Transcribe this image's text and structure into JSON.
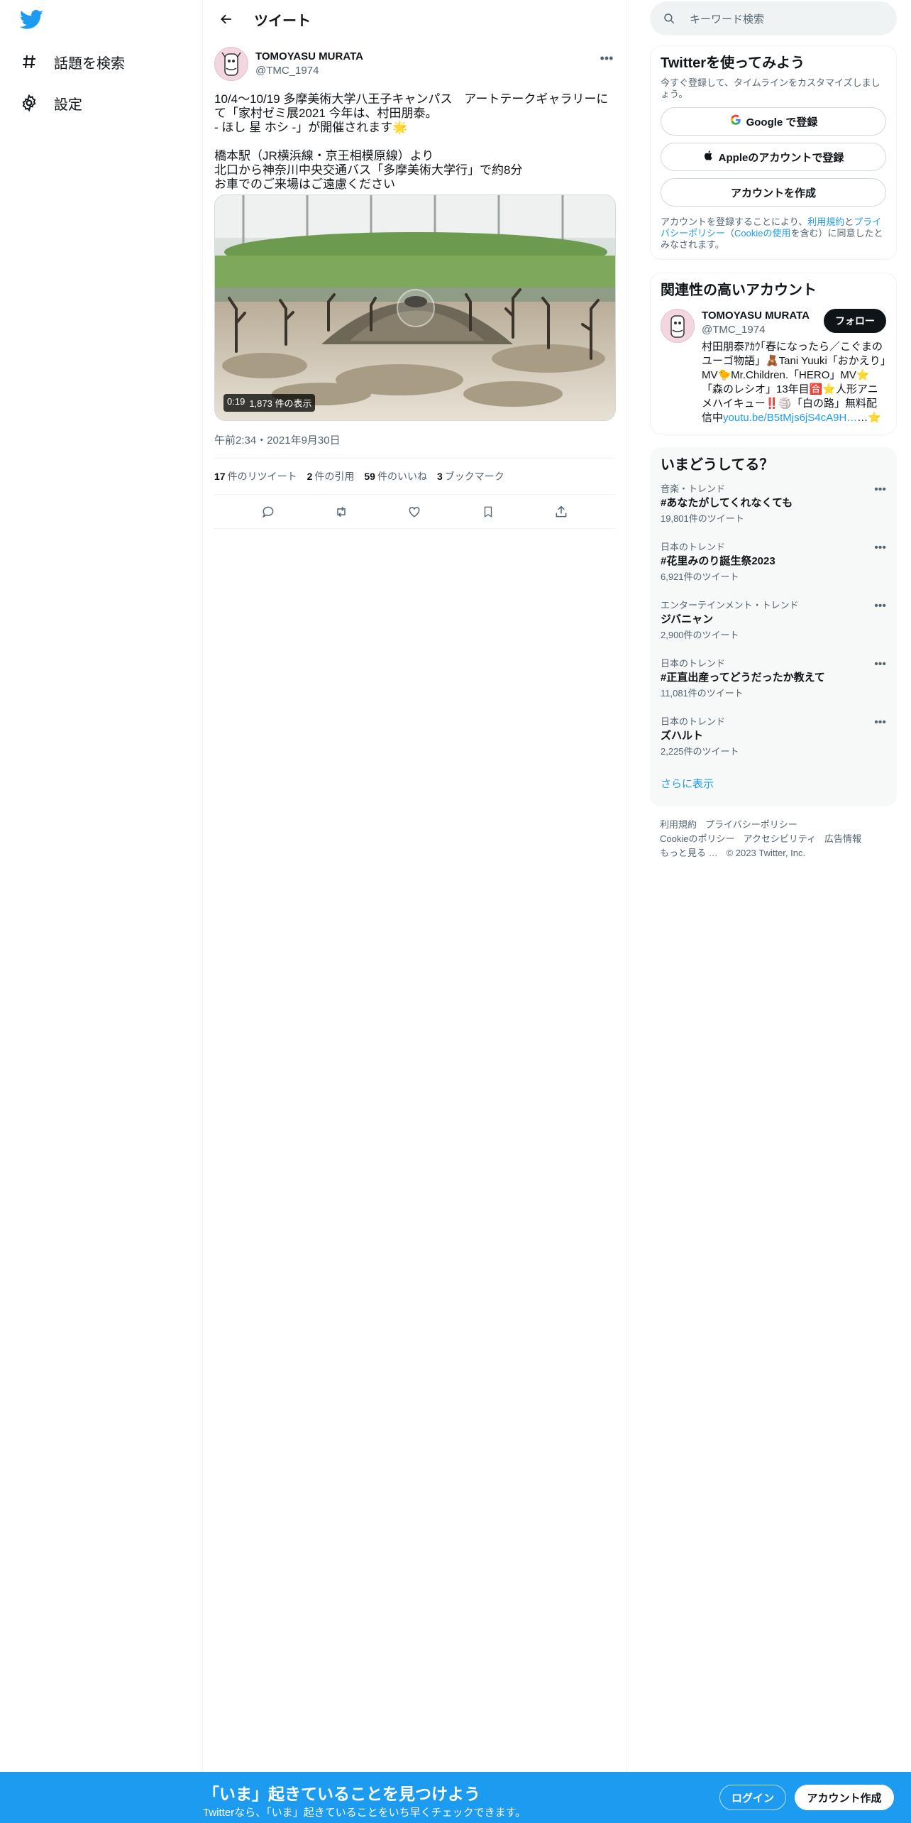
{
  "nav": {
    "explore_label": "話題を検索",
    "settings_label": "設定"
  },
  "header": {
    "title": "ツイート"
  },
  "tweet": {
    "author_name": "TOMOYASU MURATA",
    "author_handle": "@TMC_1974",
    "text": "10/4〜10/19 多摩美術大学八王子キャンパス　アートテークギャラリーにて「家村ゼミ展2021 今年は、村田朋泰。\n-  ほし 星 ホシ -」が開催されます🌟\n\n橋本駅（JR横浜線・京王相模原線）より\n北口から神奈川中央交通バス「多摩美術大学行」で約8分\nお車でのご来場はご遠慮ください",
    "video_duration": "0:19",
    "video_views": "1,873 件の表示",
    "timestamp": "午前2:34・2021年9月30日",
    "stats": {
      "retweets": "17",
      "retweets_label": "件のリツイート",
      "quotes": "2",
      "quotes_label": "件の引用",
      "likes": "59",
      "likes_label": "件のいいね",
      "bookmarks": "3",
      "bookmarks_label": "ブックマーク"
    }
  },
  "search": {
    "placeholder": "キーワード検索"
  },
  "signup": {
    "title": "Twitterを使ってみよう",
    "subtitle": "今すぐ登録して、タイムラインをカスタマイズしましょう。",
    "google_label": "Google で登録",
    "apple_label": "Appleのアカウントで登録",
    "create_label": "アカウントを作成",
    "legal_prefix": "アカウントを登録することにより、",
    "terms": "利用規約",
    "and": "と",
    "privacy": "プライバシーポリシー",
    "cookie_open": "（",
    "cookie": "Cookieの使用",
    "legal_suffix": "を含む）に同意したとみなされます。"
  },
  "related": {
    "title": "関連性の高いアカウント",
    "name": "TOMOYASU MURATA",
    "handle": "@TMC_1974",
    "follow_label": "フォロー",
    "bio": "村田朋泰ｱｶｳ｢春になったら／こぐまのユーゴ物語」🧸Tani Yuuki「おかえり」MV🐤Mr.Children.「HERO」MV⭐「森のレシオ」13年目🈴⭐人形アニメハイキュー‼️🏐「白の路」無料配信中",
    "bio_link": "youtu.be/B5tMjs6jS4cA9H…",
    "bio_tail": "…⭐"
  },
  "trends": {
    "title": "いまどうしてる？",
    "items": [
      {
        "context": "音楽・トレンド",
        "title": "#あなたがしてくれなくても",
        "count": "19,801件のツイート"
      },
      {
        "context": "日本のトレンド",
        "title": "#花里みのり誕生祭2023",
        "count": "6,921件のツイート"
      },
      {
        "context": "エンターテインメント・トレンド",
        "title": "ジバニャン",
        "count": "2,900件のツイート"
      },
      {
        "context": "日本のトレンド",
        "title": "#正直出産ってどうだったか教えて",
        "count": "11,081件のツイート"
      },
      {
        "context": "日本のトレンド",
        "title": "ズハルト",
        "count": "2,225件のツイート"
      }
    ],
    "show_more": "さらに表示"
  },
  "footer": {
    "terms": "利用規約",
    "privacy": "プライバシーポリシー",
    "cookie": "Cookieのポリシー",
    "accessibility": "アクセシビリティ",
    "ads": "広告情報",
    "more": "もっと見る …",
    "copyright": "© 2023 Twitter, Inc."
  },
  "bottom_bar": {
    "title": "「いま」起きていることを見つけよう",
    "subtitle": "Twitterなら、「いま」起きていることをいち早くチェックできます。",
    "login_label": "ログイン",
    "signup_label": "アカウント作成"
  },
  "colors": {
    "accent": "#1d9bf0",
    "text": "#0f1419",
    "muted": "#536471"
  }
}
